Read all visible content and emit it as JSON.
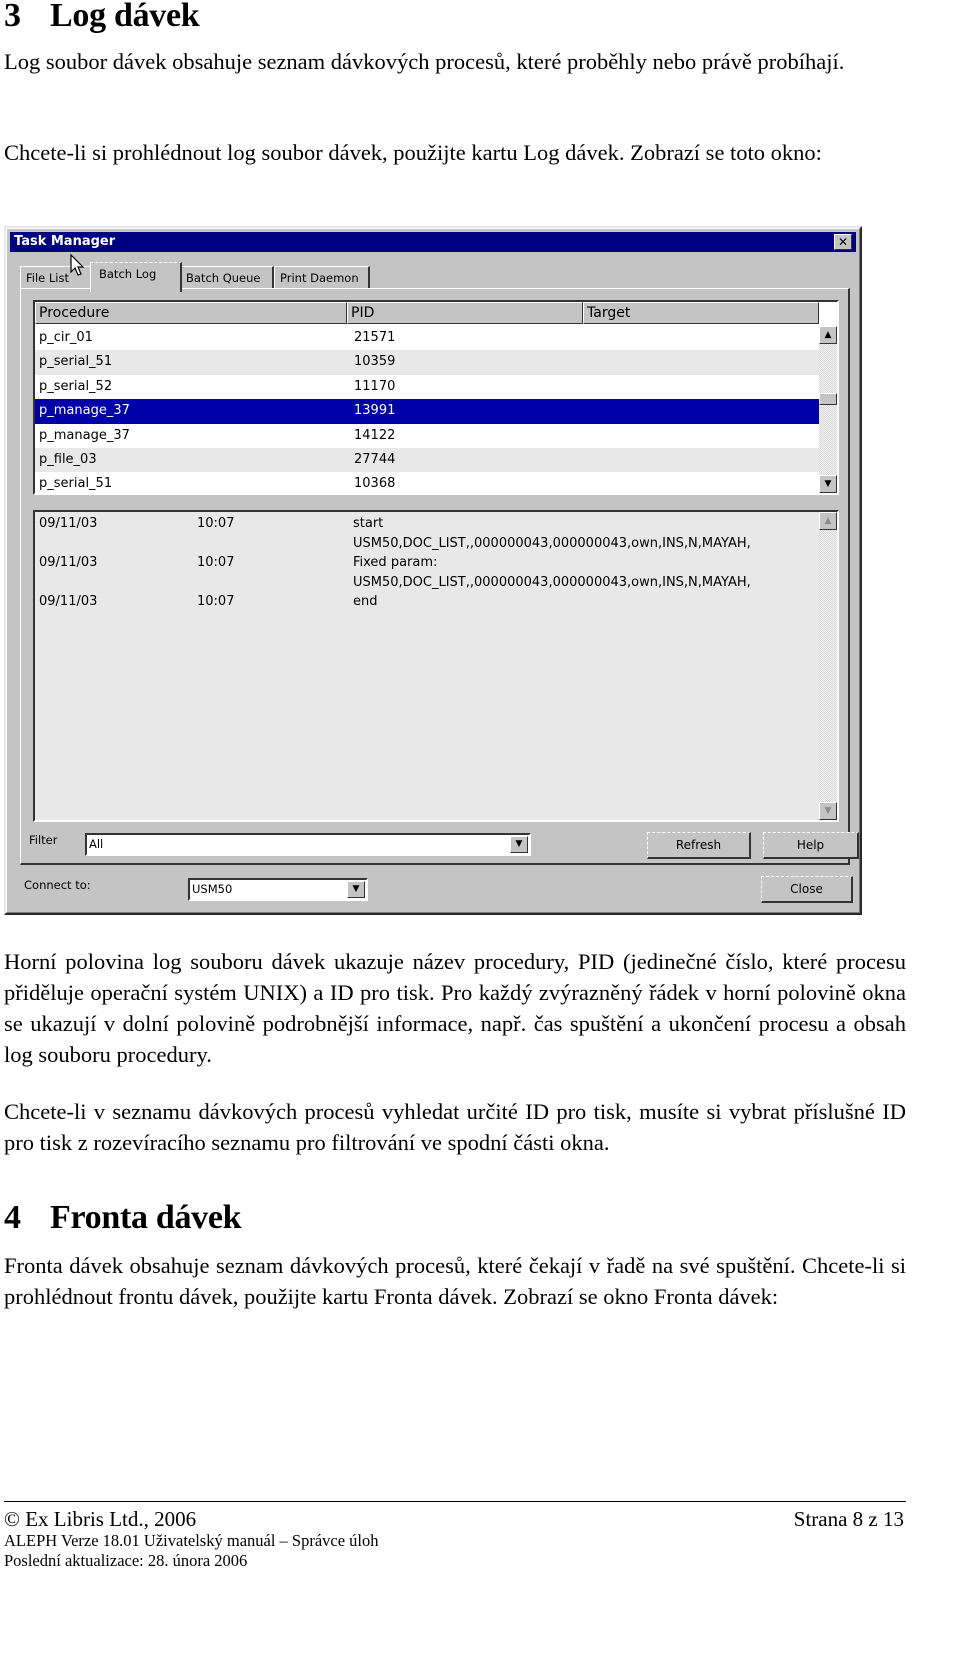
{
  "section3": {
    "number": "3",
    "title": "Log dávek",
    "para1": "Log soubor dávek obsahuje seznam dávkových procesů, které proběhly nebo právě probíhají.",
    "para2": "Chcete-li si prohlédnout log soubor dávek, použijte kartu Log dávek. Zobrazí se toto okno:"
  },
  "window": {
    "title": "Task Manager",
    "close_glyph": "✕",
    "tabs": [
      {
        "label": "File List",
        "active": false
      },
      {
        "label": "Batch Log",
        "active": true
      },
      {
        "label": "Batch Queue",
        "active": false
      },
      {
        "label": "Print Daemon",
        "active": false
      }
    ],
    "process_list": {
      "columns": [
        "Procedure",
        "PID",
        "Target"
      ],
      "rows": [
        {
          "procedure": "p_cir_01",
          "pid": "21571",
          "target": ""
        },
        {
          "procedure": "p_serial_51",
          "pid": "10359",
          "target": ""
        },
        {
          "procedure": "p_serial_52",
          "pid": "11170",
          "target": ""
        },
        {
          "procedure": "p_manage_37",
          "pid": "13991",
          "target": "",
          "selected": true
        },
        {
          "procedure": "p_manage_37",
          "pid": "14122",
          "target": ""
        },
        {
          "procedure": "p_file_03",
          "pid": "27744",
          "target": ""
        },
        {
          "procedure": "p_serial_51",
          "pid": "10368",
          "target": ""
        }
      ]
    },
    "log_list": {
      "lines": [
        {
          "date": "09/11/03",
          "time": "10:07",
          "text": "start"
        },
        {
          "date": "",
          "time": "",
          "text": "USM50,DOC_LIST,,000000043,000000043,own,INS,N,MAYAH,"
        },
        {
          "date": "09/11/03",
          "time": "10:07",
          "text": "Fixed param:"
        },
        {
          "date": "",
          "time": "",
          "text": "USM50,DOC_LIST,,000000043,000000043,own,INS,N,MAYAH,"
        },
        {
          "date": "09/11/03",
          "time": "10:07",
          "text": "end"
        }
      ]
    },
    "scroll_up_glyph": "▲",
    "scroll_down_glyph": "▼",
    "filter": {
      "label": "Filter",
      "value": "All"
    },
    "connect": {
      "label": "Connect to:",
      "value": "USM50"
    },
    "dropdown_glyph": "▼",
    "buttons": {
      "refresh": "Refresh",
      "help": "Help",
      "close": "Close"
    }
  },
  "body": {
    "para3": "Horní polovina log souboru dávek ukazuje název procedury, PID (jedinečné číslo, které procesu přiděluje operační systém UNIX) a ID pro tisk. Pro každý zvýrazněný řádek v horní polovině okna se ukazují v dolní polovině podrobnější informace, např. čas spuštění a ukončení procesu a obsah log souboru procedury.",
    "para4": "Chcete-li v seznamu dávkových procesů vyhledat určité ID pro tisk, musíte si vybrat příslušné ID pro tisk z rozevíracího seznamu pro filtrování ve spodní části okna."
  },
  "section4": {
    "number": "4",
    "title": "Fronta dávek",
    "para1": "Fronta dávek obsahuje seznam dávkových procesů, které čekají v řadě na své spuštění. Chcete-li si prohlédnout frontu dávek, použijte kartu Fronta dávek. Zobrazí se okno Fronta dávek:"
  },
  "footer": {
    "copyright": "© Ex Libris Ltd., 2006",
    "page": "Strana 8 z 13",
    "manual": "ALEPH Verze 18.01 Uživatelský manuál – Správce úloh",
    "updated": "Poslední aktualizace: 28. února 2006"
  }
}
